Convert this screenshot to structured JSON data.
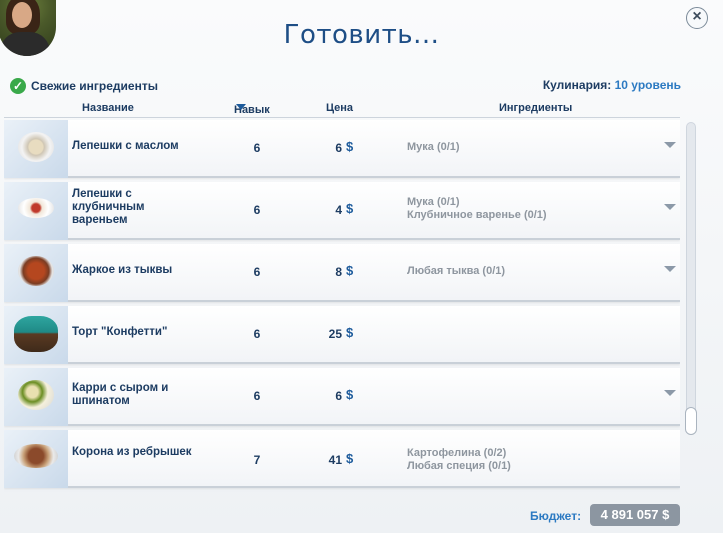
{
  "dialog": {
    "title": "Готовить...",
    "close_label": "×",
    "fresh_ingredients": {
      "checked": true,
      "check_glyph": "✓",
      "label": "Свежие ингредиенты"
    },
    "skill": {
      "label": "Кулинария:",
      "level": "10 уровень"
    }
  },
  "columns": {
    "name": "Название",
    "skill": "Навык",
    "price": "Цена",
    "ingredients": "Ингредиенты"
  },
  "recipes": [
    {
      "name": "Лепешки с маслом",
      "skill": "6",
      "price": "6",
      "currency": "$",
      "ingredients": [
        "Мука (0/1)",
        ""
      ],
      "expandable": true,
      "dish_icon": "pancakes-butter-icon"
    },
    {
      "name": "Лепешки с клубничным вареньем",
      "skill": "6",
      "price": "4",
      "currency": "$",
      "ingredients": [
        "Мука (0/1)",
        "Клубничное варенье (0/1)"
      ],
      "expandable": true,
      "dish_icon": "pancakes-jam-icon"
    },
    {
      "name": "Жаркое из тыквы",
      "skill": "6",
      "price": "8",
      "currency": "$",
      "ingredients": [
        "Любая тыква (0/1)",
        ""
      ],
      "expandable": true,
      "dish_icon": "pumpkin-stew-icon"
    },
    {
      "name": "Торт \"Конфетти\"",
      "skill": "6",
      "price": "25",
      "currency": "$",
      "ingredients": [
        "",
        ""
      ],
      "expandable": false,
      "dish_icon": "confetti-cake-icon"
    },
    {
      "name": "Карри с сыром и шпинатом",
      "skill": "6",
      "price": "6",
      "currency": "$",
      "ingredients": [
        "",
        ""
      ],
      "expandable": true,
      "dish_icon": "spinach-curry-icon"
    },
    {
      "name": "Корона из ребрышек",
      "skill": "7",
      "price": "41",
      "currency": "$",
      "ingredients": [
        "Картофелина (0/2)",
        "Любая специя (0/1)"
      ],
      "expandable": false,
      "dish_icon": "rib-crown-icon"
    }
  ],
  "footer": {
    "budget_label": "Бюджет:",
    "budget_value": "4 891 057 $"
  },
  "colors": {
    "title": "#1e4e86",
    "accent": "#2c7ac2",
    "check": "#3aa94a"
  }
}
